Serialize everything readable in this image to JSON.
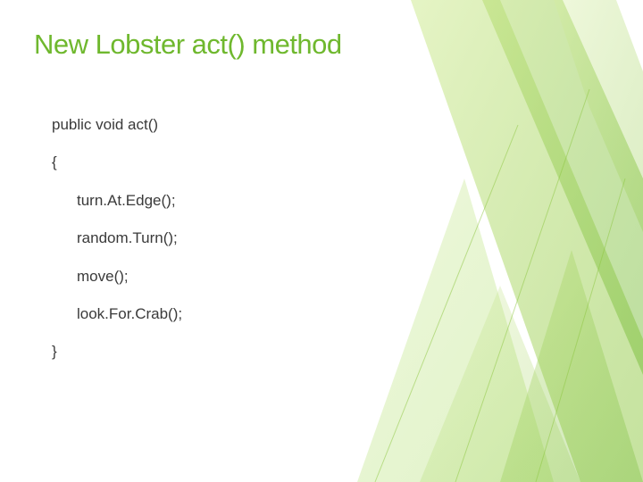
{
  "title": "New Lobster act() method",
  "code": {
    "signature": "public void act()",
    "open_brace": "{",
    "lines": [
      "turn.At.Edge();",
      "random.Turn();",
      "move();",
      "look.For.Crab();"
    ],
    "close_brace": "}"
  },
  "colors": {
    "accent": "#6fb82e",
    "text": "#3a3a3a"
  }
}
